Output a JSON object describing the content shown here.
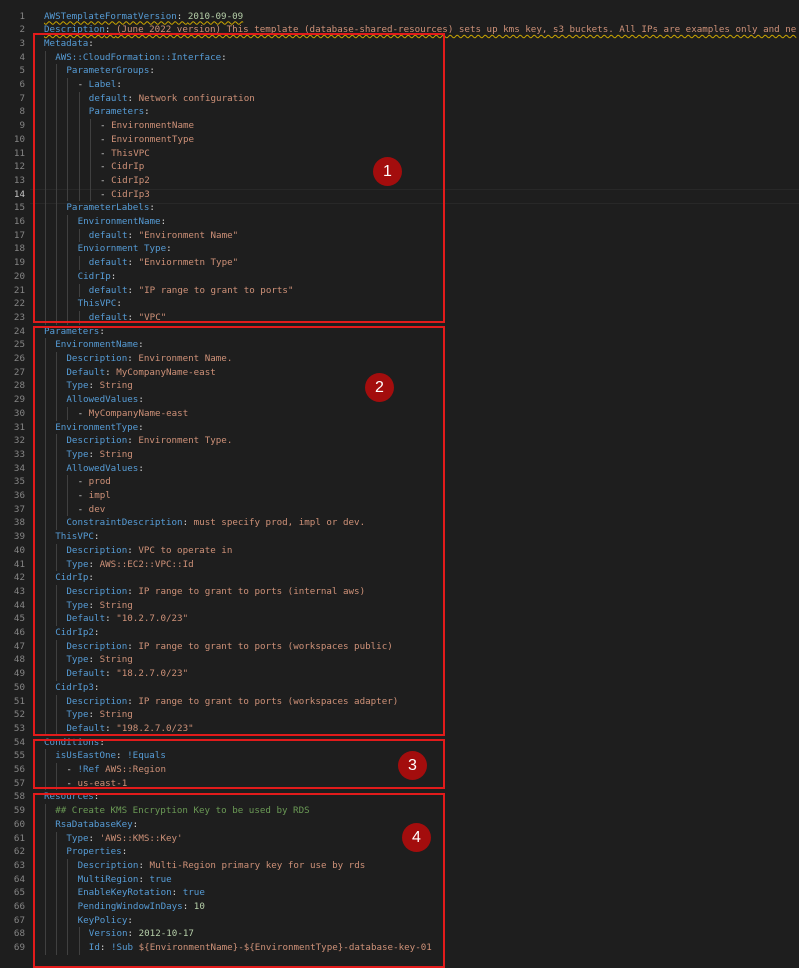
{
  "editor": {
    "current_line": 14,
    "lines": [
      {
        "n": "1",
        "i": 0,
        "t": [
          [
            "k",
            "AWSTemplateFormatVersion"
          ],
          [
            "p",
            ": "
          ],
          [
            "n",
            "2010-09-09"
          ]
        ],
        "sq": true
      },
      {
        "n": "2",
        "i": 0,
        "t": [
          [
            "k",
            "Description"
          ],
          [
            "p",
            ": "
          ],
          [
            "s",
            "(June 2022 version) This template (database-shared-resources) sets up kms key, s3 buckets. All IPs are examples only and ne"
          ]
        ],
        "sq": true
      },
      {
        "n": "3",
        "i": 0,
        "t": [
          [
            "k",
            "Metadata"
          ],
          [
            "p",
            ":"
          ]
        ]
      },
      {
        "n": "4",
        "i": 1,
        "t": [
          [
            "k",
            "AWS::CloudFormation::Interface"
          ],
          [
            "p",
            ":"
          ]
        ]
      },
      {
        "n": "5",
        "i": 2,
        "t": [
          [
            "k",
            "ParameterGroups"
          ],
          [
            "p",
            ":"
          ]
        ]
      },
      {
        "n": "6",
        "i": 3,
        "t": [
          [
            "p",
            "- "
          ],
          [
            "k",
            "Label"
          ],
          [
            "p",
            ":"
          ]
        ]
      },
      {
        "n": "7",
        "i": 4,
        "t": [
          [
            "k",
            "default"
          ],
          [
            "p",
            ": "
          ],
          [
            "s",
            "Network configuration"
          ]
        ]
      },
      {
        "n": "8",
        "i": 4,
        "t": [
          [
            "k",
            "Parameters"
          ],
          [
            "p",
            ":"
          ]
        ]
      },
      {
        "n": "9",
        "i": 5,
        "t": [
          [
            "p",
            "- "
          ],
          [
            "s",
            "EnvironmentName"
          ]
        ]
      },
      {
        "n": "10",
        "i": 5,
        "t": [
          [
            "p",
            "- "
          ],
          [
            "s",
            "EnvironmentType"
          ]
        ]
      },
      {
        "n": "11",
        "i": 5,
        "t": [
          [
            "p",
            "- "
          ],
          [
            "s",
            "ThisVPC"
          ]
        ]
      },
      {
        "n": "12",
        "i": 5,
        "t": [
          [
            "p",
            "- "
          ],
          [
            "s",
            "CidrIp"
          ]
        ]
      },
      {
        "n": "13",
        "i": 5,
        "t": [
          [
            "p",
            "- "
          ],
          [
            "s",
            "CidrIp2"
          ]
        ]
      },
      {
        "n": "14",
        "i": 5,
        "t": [
          [
            "p",
            "- "
          ],
          [
            "s",
            "CidrIp3"
          ]
        ]
      },
      {
        "n": "15",
        "i": 2,
        "t": [
          [
            "k",
            "ParameterLabels"
          ],
          [
            "p",
            ":"
          ]
        ]
      },
      {
        "n": "16",
        "i": 3,
        "t": [
          [
            "k",
            "EnvironmentName"
          ],
          [
            "p",
            ":"
          ]
        ]
      },
      {
        "n": "17",
        "i": 4,
        "t": [
          [
            "k",
            "default"
          ],
          [
            "p",
            ": "
          ],
          [
            "s",
            "\"Environment Name\""
          ]
        ]
      },
      {
        "n": "18",
        "i": 3,
        "t": [
          [
            "k",
            "Enviornment Type"
          ],
          [
            "p",
            ":"
          ]
        ]
      },
      {
        "n": "19",
        "i": 4,
        "t": [
          [
            "k",
            "default"
          ],
          [
            "p",
            ": "
          ],
          [
            "s",
            "\"Enviornmetn Type\""
          ]
        ]
      },
      {
        "n": "20",
        "i": 3,
        "t": [
          [
            "k",
            "CidrIp"
          ],
          [
            "p",
            ":"
          ]
        ]
      },
      {
        "n": "21",
        "i": 4,
        "t": [
          [
            "k",
            "default"
          ],
          [
            "p",
            ": "
          ],
          [
            "s",
            "\"IP range to grant to ports\""
          ]
        ]
      },
      {
        "n": "22",
        "i": 3,
        "t": [
          [
            "k",
            "ThisVPC"
          ],
          [
            "p",
            ":"
          ]
        ]
      },
      {
        "n": "23",
        "i": 4,
        "t": [
          [
            "k",
            "default"
          ],
          [
            "p",
            ": "
          ],
          [
            "s",
            "\"VPC\""
          ]
        ]
      },
      {
        "n": "24",
        "i": 0,
        "t": [
          [
            "k",
            "Parameters"
          ],
          [
            "p",
            ":"
          ]
        ]
      },
      {
        "n": "25",
        "i": 1,
        "t": [
          [
            "k",
            "EnvironmentName"
          ],
          [
            "p",
            ":"
          ]
        ]
      },
      {
        "n": "26",
        "i": 2,
        "t": [
          [
            "k",
            "Description"
          ],
          [
            "p",
            ": "
          ],
          [
            "s",
            "Environment Name."
          ]
        ]
      },
      {
        "n": "27",
        "i": 2,
        "t": [
          [
            "k",
            "Default"
          ],
          [
            "p",
            ": "
          ],
          [
            "s",
            "MyCompanyName-east"
          ]
        ]
      },
      {
        "n": "28",
        "i": 2,
        "t": [
          [
            "k",
            "Type"
          ],
          [
            "p",
            ": "
          ],
          [
            "s",
            "String"
          ]
        ]
      },
      {
        "n": "29",
        "i": 2,
        "t": [
          [
            "k",
            "AllowedValues"
          ],
          [
            "p",
            ":"
          ]
        ]
      },
      {
        "n": "30",
        "i": 3,
        "t": [
          [
            "p",
            "- "
          ],
          [
            "s",
            "MyCompanyName-east"
          ]
        ]
      },
      {
        "n": "31",
        "i": 1,
        "t": [
          [
            "k",
            "EnvironmentType"
          ],
          [
            "p",
            ":"
          ]
        ]
      },
      {
        "n": "32",
        "i": 2,
        "t": [
          [
            "k",
            "Description"
          ],
          [
            "p",
            ": "
          ],
          [
            "s",
            "Environment Type."
          ]
        ]
      },
      {
        "n": "33",
        "i": 2,
        "t": [
          [
            "k",
            "Type"
          ],
          [
            "p",
            ": "
          ],
          [
            "s",
            "String"
          ]
        ]
      },
      {
        "n": "34",
        "i": 2,
        "t": [
          [
            "k",
            "AllowedValues"
          ],
          [
            "p",
            ":"
          ]
        ]
      },
      {
        "n": "35",
        "i": 3,
        "t": [
          [
            "p",
            "- "
          ],
          [
            "s",
            "prod"
          ]
        ]
      },
      {
        "n": "36",
        "i": 3,
        "t": [
          [
            "p",
            "- "
          ],
          [
            "s",
            "impl"
          ]
        ]
      },
      {
        "n": "37",
        "i": 3,
        "t": [
          [
            "p",
            "- "
          ],
          [
            "s",
            "dev"
          ]
        ]
      },
      {
        "n": "38",
        "i": 2,
        "t": [
          [
            "k",
            "ConstraintDescription"
          ],
          [
            "p",
            ": "
          ],
          [
            "s",
            "must specify prod, impl or dev."
          ]
        ]
      },
      {
        "n": "39",
        "i": 1,
        "t": [
          [
            "k",
            "ThisVPC"
          ],
          [
            "p",
            ":"
          ]
        ]
      },
      {
        "n": "40",
        "i": 2,
        "t": [
          [
            "k",
            "Description"
          ],
          [
            "p",
            ": "
          ],
          [
            "s",
            "VPC to operate in"
          ]
        ]
      },
      {
        "n": "41",
        "i": 2,
        "t": [
          [
            "k",
            "Type"
          ],
          [
            "p",
            ": "
          ],
          [
            "s",
            "AWS::EC2::VPC::Id"
          ]
        ]
      },
      {
        "n": "42",
        "i": 1,
        "t": [
          [
            "k",
            "CidrIp"
          ],
          [
            "p",
            ":"
          ]
        ]
      },
      {
        "n": "43",
        "i": 2,
        "t": [
          [
            "k",
            "Description"
          ],
          [
            "p",
            ": "
          ],
          [
            "s",
            "IP range to grant to ports (internal aws)"
          ]
        ]
      },
      {
        "n": "44",
        "i": 2,
        "t": [
          [
            "k",
            "Type"
          ],
          [
            "p",
            ": "
          ],
          [
            "s",
            "String"
          ]
        ]
      },
      {
        "n": "45",
        "i": 2,
        "t": [
          [
            "k",
            "Default"
          ],
          [
            "p",
            ": "
          ],
          [
            "s",
            "\"10.2.7.0/23\""
          ]
        ]
      },
      {
        "n": "46",
        "i": 1,
        "t": [
          [
            "k",
            "CidrIp2"
          ],
          [
            "p",
            ":"
          ]
        ]
      },
      {
        "n": "47",
        "i": 2,
        "t": [
          [
            "k",
            "Description"
          ],
          [
            "p",
            ": "
          ],
          [
            "s",
            "IP range to grant to ports (workspaces public)"
          ]
        ]
      },
      {
        "n": "48",
        "i": 2,
        "t": [
          [
            "k",
            "Type"
          ],
          [
            "p",
            ": "
          ],
          [
            "s",
            "String"
          ]
        ]
      },
      {
        "n": "49",
        "i": 2,
        "t": [
          [
            "k",
            "Default"
          ],
          [
            "p",
            ": "
          ],
          [
            "s",
            "\"18.2.7.0/23\""
          ]
        ]
      },
      {
        "n": "50",
        "i": 1,
        "t": [
          [
            "k",
            "CidrIp3"
          ],
          [
            "p",
            ":"
          ]
        ]
      },
      {
        "n": "51",
        "i": 2,
        "t": [
          [
            "k",
            "Description"
          ],
          [
            "p",
            ": "
          ],
          [
            "s",
            "IP range to grant to ports (workspaces adapter)"
          ]
        ]
      },
      {
        "n": "52",
        "i": 2,
        "t": [
          [
            "k",
            "Type"
          ],
          [
            "p",
            ": "
          ],
          [
            "s",
            "String"
          ]
        ]
      },
      {
        "n": "53",
        "i": 2,
        "t": [
          [
            "k",
            "Default"
          ],
          [
            "p",
            ": "
          ],
          [
            "s",
            "\"198.2.7.0/23\""
          ]
        ]
      },
      {
        "n": "54",
        "i": 0,
        "t": [
          [
            "k",
            "Conditions"
          ],
          [
            "p",
            ":"
          ]
        ]
      },
      {
        "n": "55",
        "i": 1,
        "t": [
          [
            "k",
            "isUsEastOne"
          ],
          [
            "p",
            ": "
          ],
          [
            "kw",
            "!Equals"
          ]
        ]
      },
      {
        "n": "56",
        "i": 2,
        "t": [
          [
            "p",
            "- "
          ],
          [
            "kw",
            "!Ref "
          ],
          [
            "s",
            "AWS::Region"
          ]
        ]
      },
      {
        "n": "57",
        "i": 2,
        "t": [
          [
            "p",
            "- "
          ],
          [
            "s",
            "us-east-1"
          ]
        ]
      },
      {
        "n": "58",
        "i": 0,
        "t": [
          [
            "k",
            "Resources"
          ],
          [
            "p",
            ":"
          ]
        ]
      },
      {
        "n": "59",
        "i": 1,
        "t": [
          [
            "c",
            "## Create KMS Encryption Key to be used by RDS"
          ]
        ]
      },
      {
        "n": "60",
        "i": 1,
        "t": [
          [
            "k",
            "RsaDatabaseKey"
          ],
          [
            "p",
            ":"
          ]
        ]
      },
      {
        "n": "61",
        "i": 2,
        "t": [
          [
            "k",
            "Type"
          ],
          [
            "p",
            ": "
          ],
          [
            "s",
            "'AWS::KMS::Key'"
          ]
        ]
      },
      {
        "n": "62",
        "i": 2,
        "t": [
          [
            "k",
            "Properties"
          ],
          [
            "p",
            ":"
          ]
        ]
      },
      {
        "n": "63",
        "i": 3,
        "t": [
          [
            "k",
            "Description"
          ],
          [
            "p",
            ": "
          ],
          [
            "s",
            "Multi-Region primary key for use by rds"
          ]
        ]
      },
      {
        "n": "64",
        "i": 3,
        "t": [
          [
            "k",
            "MultiRegion"
          ],
          [
            "p",
            ": "
          ],
          [
            "kw",
            "true"
          ]
        ]
      },
      {
        "n": "65",
        "i": 3,
        "t": [
          [
            "k",
            "EnableKeyRotation"
          ],
          [
            "p",
            ": "
          ],
          [
            "kw",
            "true"
          ]
        ]
      },
      {
        "n": "66",
        "i": 3,
        "t": [
          [
            "k",
            "PendingWindowInDays"
          ],
          [
            "p",
            ": "
          ],
          [
            "n",
            "10"
          ]
        ]
      },
      {
        "n": "67",
        "i": 3,
        "t": [
          [
            "k",
            "KeyPolicy"
          ],
          [
            "p",
            ":"
          ]
        ]
      },
      {
        "n": "68",
        "i": 4,
        "t": [
          [
            "k",
            "Version"
          ],
          [
            "p",
            ": "
          ],
          [
            "n",
            "2012-10-17"
          ]
        ]
      },
      {
        "n": "69",
        "i": 4,
        "t": [
          [
            "k",
            "Id"
          ],
          [
            "p",
            ": "
          ],
          [
            "kw",
            "!Sub "
          ],
          [
            "s",
            "${EnvironmentName}-${EnvironmentType}-database-key-01"
          ]
        ]
      },
      {
        "n": "",
        "i": 0,
        "t": []
      }
    ]
  },
  "annotations": [
    {
      "label": "1"
    },
    {
      "label": "2"
    },
    {
      "label": "3"
    },
    {
      "label": "4"
    }
  ],
  "colors": {
    "background": "#1e1e1e",
    "key": "#569cd6",
    "string": "#ce9178",
    "number": "#b5cea8",
    "comment": "#6a9955",
    "annotation_box": "#e21b1b",
    "annotation_badge": "#a30d0d"
  }
}
